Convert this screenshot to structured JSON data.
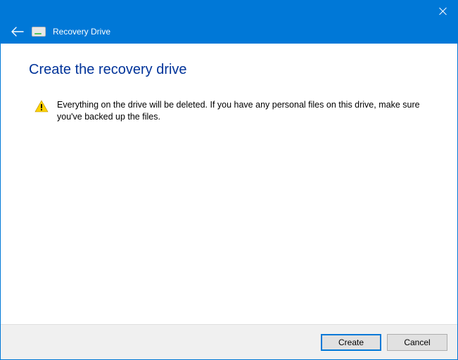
{
  "window": {
    "title": "Recovery Drive"
  },
  "page": {
    "heading": "Create the recovery drive",
    "warning_text": "Everything on the drive will be deleted. If you have any personal files on this drive, make sure you've backed up the files."
  },
  "footer": {
    "primary_button": "Create",
    "cancel_button": "Cancel"
  },
  "colors": {
    "accent": "#0078d7",
    "heading": "#003399"
  }
}
